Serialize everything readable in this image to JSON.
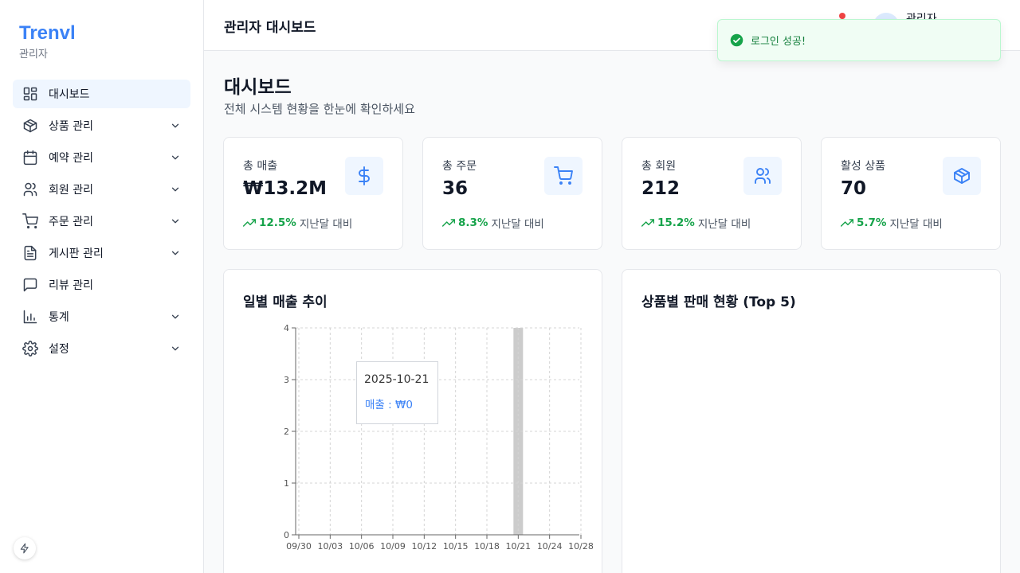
{
  "brand": {
    "name": "Trenvl",
    "subtitle": "관리자"
  },
  "sidebar": {
    "items": [
      {
        "label": "대시보드",
        "icon": "dashboard-icon",
        "active": true,
        "expandable": false
      },
      {
        "label": "상품 관리",
        "icon": "package-icon",
        "active": false,
        "expandable": true
      },
      {
        "label": "예약 관리",
        "icon": "calendar-icon",
        "active": false,
        "expandable": true
      },
      {
        "label": "회원 관리",
        "icon": "users-icon",
        "active": false,
        "expandable": true
      },
      {
        "label": "주문 관리",
        "icon": "cart-icon",
        "active": false,
        "expandable": true
      },
      {
        "label": "게시판 관리",
        "icon": "file-text-icon",
        "active": false,
        "expandable": true
      },
      {
        "label": "리뷰 관리",
        "icon": "message-square-icon",
        "active": false,
        "expandable": false
      },
      {
        "label": "통계",
        "icon": "bar-chart-icon",
        "active": false,
        "expandable": true
      },
      {
        "label": "설정",
        "icon": "gear-icon",
        "active": false,
        "expandable": true
      }
    ]
  },
  "header": {
    "title": "관리자 대시보드",
    "user_name": "관리자"
  },
  "toast": {
    "message": "로그인 성공!",
    "icon": "check-circle-icon"
  },
  "page": {
    "title": "대시보드",
    "subtitle": "전체 시스템 현황을 한눈에 확인하세요"
  },
  "stats": [
    {
      "label": "총 매출",
      "value": "₩13.2M",
      "trend": "12.5%",
      "compare": "지난달 대비",
      "icon": "dollar-icon"
    },
    {
      "label": "총 주문",
      "value": "36",
      "trend": "8.3%",
      "compare": "지난달 대비",
      "icon": "cart-icon"
    },
    {
      "label": "총 회원",
      "value": "212",
      "trend": "15.2%",
      "compare": "지난달 대비",
      "icon": "users-icon"
    },
    {
      "label": "활성 상품",
      "value": "70",
      "trend": "5.7%",
      "compare": "지난달 대비",
      "icon": "package-icon"
    }
  ],
  "sales_panel": {
    "title": "일별 매출 추이"
  },
  "products_panel": {
    "title": "상품별 판매 현황 (Top 5)"
  },
  "tooltip": {
    "date": "2025-10-21",
    "value_text": "매출 : ₩0"
  },
  "colors": {
    "accent": "#3b82f6",
    "success": "#16a34a",
    "danger": "#ef4444",
    "highlight_bar": "#cccccc"
  },
  "chart_data": {
    "type": "line",
    "title": "일별 매출 추이",
    "xlabel": "",
    "ylabel": "",
    "ylim": [
      0,
      4
    ],
    "yticks": [
      0,
      1,
      2,
      3,
      4
    ],
    "xticks": [
      "09/30",
      "10/03",
      "10/06",
      "10/09",
      "10/12",
      "10/15",
      "10/18",
      "10/21",
      "10/24",
      "10/28"
    ],
    "grid": true,
    "highlight": "10/21",
    "series": [
      {
        "values": [
          0,
          0,
          0,
          0,
          0,
          0,
          0,
          0,
          0,
          0
        ]
      }
    ]
  }
}
